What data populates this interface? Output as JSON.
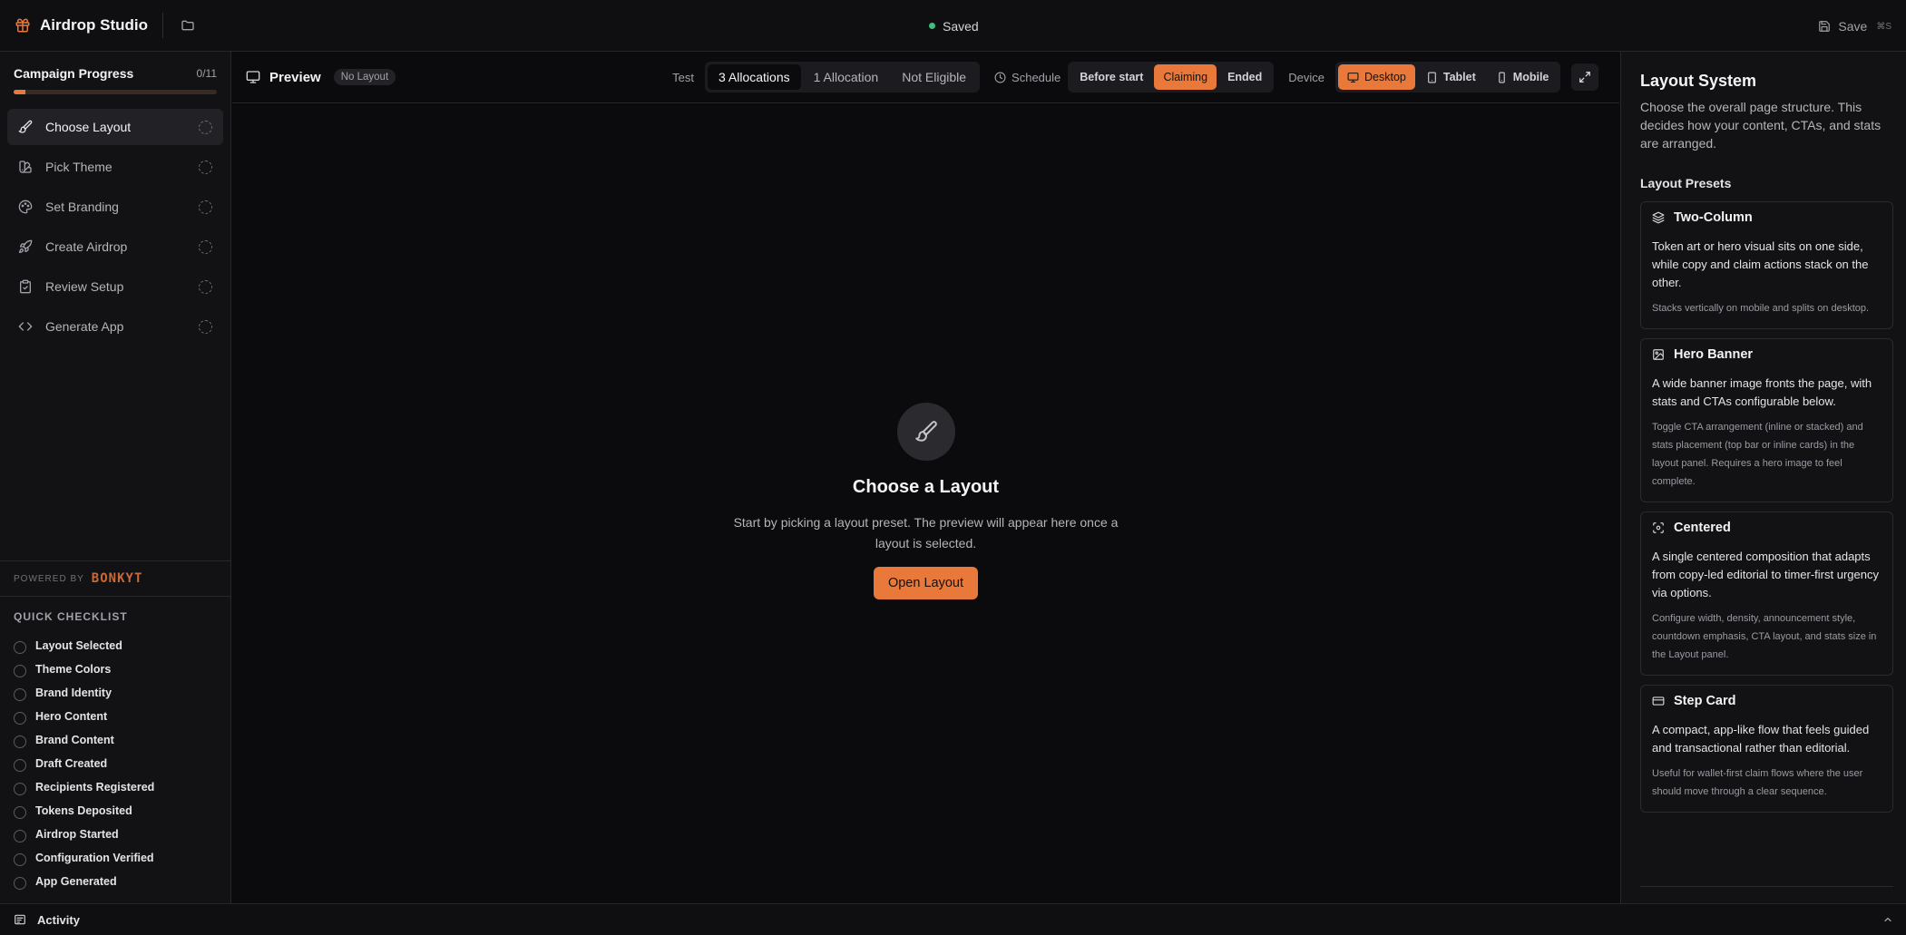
{
  "app": {
    "title": "Airdrop Studio",
    "status": "Saved",
    "save_label": "Save",
    "save_shortcut": "⌘S"
  },
  "sidebar": {
    "progress_title": "Campaign Progress",
    "progress_count": "0/11",
    "progress_fraction": 0.06,
    "steps": [
      {
        "label": "Choose Layout",
        "icon": "brush-icon",
        "active": true
      },
      {
        "label": "Pick Theme",
        "icon": "swatch-icon",
        "active": false
      },
      {
        "label": "Set Branding",
        "icon": "palette-icon",
        "active": false
      },
      {
        "label": "Create Airdrop",
        "icon": "rocket-icon",
        "active": false
      },
      {
        "label": "Review Setup",
        "icon": "clipboard-check-icon",
        "active": false
      },
      {
        "label": "Generate App",
        "icon": "code-icon",
        "active": false
      }
    ],
    "powered_by": "POWERED BY",
    "powered_logo": "BONKYT",
    "checklist_title": "QUICK CHECKLIST",
    "checklist": [
      "Layout Selected",
      "Theme Colors",
      "Brand Identity",
      "Hero Content",
      "Brand Content",
      "Draft Created",
      "Recipients Registered",
      "Tokens Deposited",
      "Airdrop Started",
      "Configuration Verified",
      "App Generated"
    ]
  },
  "toolbar": {
    "preview_label": "Preview",
    "layout_badge": "No Layout",
    "test_label": "Test",
    "test_options": [
      "3 Allocations",
      "1 Allocation",
      "Not Eligible"
    ],
    "schedule_label": "Schedule",
    "schedule_options": [
      "Before start",
      "Claiming",
      "Ended"
    ],
    "device_label": "Device",
    "device_options": [
      "Desktop",
      "Tablet",
      "Mobile"
    ]
  },
  "canvas": {
    "empty_title": "Choose a Layout",
    "empty_desc": "Start by picking a layout preset. The preview will appear here once a layout is selected.",
    "open_button": "Open Layout"
  },
  "panel": {
    "title": "Layout System",
    "desc": "Choose the overall page structure. This decides how your content, CTAs, and stats are arranged.",
    "presets_title": "Layout Presets",
    "presets": [
      {
        "name": "Two-Column",
        "icon": "layers-icon",
        "desc": "Token art or hero visual sits on one side, while copy and claim actions stack on the other.",
        "note": "Stacks vertically on mobile and splits on desktop."
      },
      {
        "name": "Hero Banner",
        "icon": "image-icon",
        "desc": "A wide banner image fronts the page, with stats and CTAs configurable below.",
        "note": "Toggle CTA arrangement (inline or stacked) and stats placement (top bar or inline cards) in the layout panel. Requires a hero image to feel complete."
      },
      {
        "name": "Centered",
        "icon": "focus-icon",
        "desc": "A single centered composition that adapts from copy-led editorial to timer-first urgency via options.",
        "note": "Configure width, density, announcement style, countdown emphasis, CTA layout, and stats size in the Layout panel."
      },
      {
        "name": "Step Card",
        "icon": "credit-card-icon",
        "desc": "A compact, app-like flow that feels guided and transactional rather than editorial.",
        "note": "Useful for wallet-first claim flows where the user should move through a clear sequence."
      }
    ]
  },
  "activity": {
    "label": "Activity"
  },
  "colors": {
    "accent": "#e8793a",
    "saved_dot": "#3fbf7f",
    "background": "#0b0b0d"
  }
}
